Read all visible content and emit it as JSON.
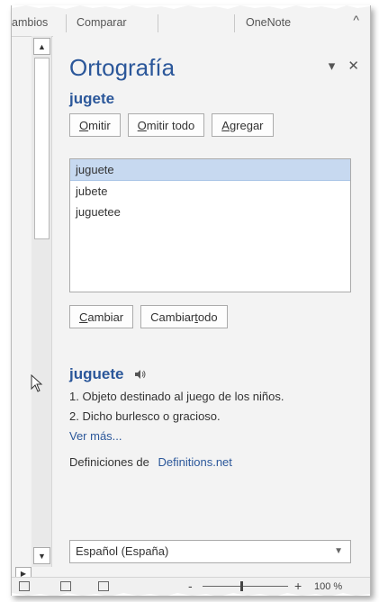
{
  "ribbon": {
    "tabs": [
      "ambios",
      "Comparar",
      "OneNote"
    ],
    "collapse_glyph": "^"
  },
  "pane": {
    "title": "Ortografía",
    "pin_glyph": "▾",
    "close_glyph": "✕",
    "misspelled_word": "jugete",
    "buttons_top": {
      "ignore": "Omitir",
      "ignore_all": "Omitir todo",
      "add": "Agregar"
    },
    "suggestions": [
      "juguete",
      "jubete",
      "juguetee"
    ],
    "selected_suggestion_index": 0,
    "buttons_bottom": {
      "change": "Cambiar",
      "change_all": "Cambiar todo"
    },
    "definition": {
      "word": "juguete",
      "speaker_icon": "speaker-icon",
      "lines": [
        "1. Objeto destinado al juego de los niños.",
        "2. Dicho burlesco o gracioso."
      ],
      "more_link": "Ver más...",
      "source_label": "Definiciones de",
      "source_link": "Definitions.net"
    },
    "language": "Español (España)"
  },
  "status_bar": {
    "zoom_minus": "-",
    "zoom_plus": "+",
    "zoom_percent": "100 %",
    "zoom_level_fraction": 0.45
  },
  "colors": {
    "accent": "#2b579a",
    "selected_row": "#c7d9f0",
    "pane_background": "#f3f3f3"
  }
}
